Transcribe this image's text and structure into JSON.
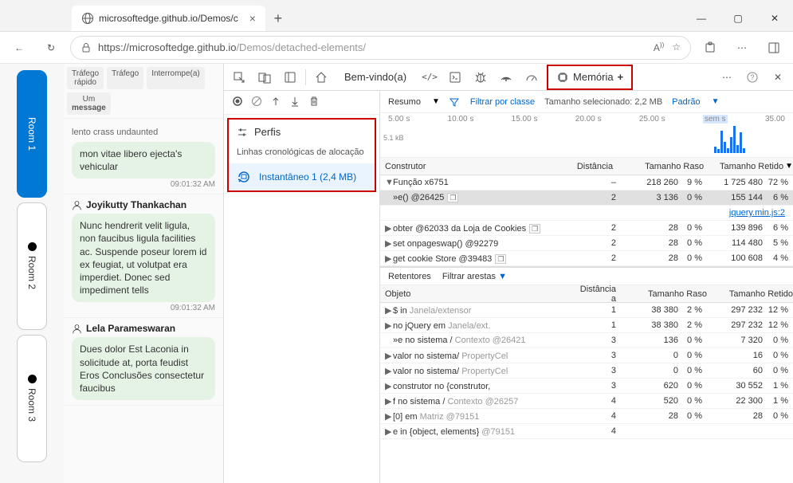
{
  "browser": {
    "tab_title": "microsoftedge.github.io/Demos/c",
    "url_prefix": "https://microsoftedge.github.io",
    "url_suffix": "/Demos/detached-elements/"
  },
  "rooms": [
    {
      "label": "Room 1",
      "active": true
    },
    {
      "label": "Room 2",
      "active": false
    },
    {
      "label": "Room 3",
      "active": false
    }
  ],
  "chat_tabs": [
    {
      "l1": "Tráfego",
      "l2": "rápido"
    },
    {
      "l1": "Tráfego",
      "l2": ""
    },
    {
      "l1": "Interrompe(a)",
      "l2": ""
    },
    {
      "l1": "Um",
      "l2": "message"
    }
  ],
  "messages": [
    {
      "preline": "lento crass undaunted",
      "text": "mon vitae libero ejecta's vehicular",
      "time": "09:01:32 AM"
    },
    {
      "user": "Joyikutty Thankachan",
      "text": "Nunc hendrerit velit ligula, non faucibus ligula facilities ac. Suspende poseur lorem id ex feugiat, ut volutpat era imperdiet. Donec sed impediment tells",
      "time": "09:01:32 AM"
    },
    {
      "user": "Lela Parameswaran",
      "text": "Dues dolor Est Laconia in solicitude at, porta feudist Eros  Conclusões consectetur faucibus"
    }
  ],
  "devtools": {
    "welcome": "Bem-vindo(a)",
    "memory": "Memória",
    "plus": "+",
    "perfis": "Perfis",
    "alloc_timelines": "Linhas cronológicas de alocação",
    "snapshot": "Instantâneo 1 (2,4 MB)"
  },
  "filter": {
    "summary": "Resumo",
    "filter_class": "Filtrar por classe",
    "size_label": "Tamanho selecionado:",
    "size_val": "2,2 MB",
    "display_label": "Padrão"
  },
  "timeline": {
    "ticks": [
      "5.00 s",
      "10.00 s",
      "15.00 s",
      "20.00 s",
      "25.00 s",
      "sem s",
      "35.00"
    ],
    "ylabel": "5.1 kB"
  },
  "constructors": {
    "headers": [
      "Construtor",
      "Distância",
      "Tamanho Raso",
      "Tamanho Retido"
    ],
    "rows": [
      {
        "tri": "▼",
        "name": "Função x6751",
        "badge": "",
        "dist": "–",
        "raw": "218 260",
        "rawp": "9 %",
        "ret": "1 725 480",
        "retp": "72 %"
      },
      {
        "tri": "",
        "name": "»e() @26425",
        "badge": "❐",
        "dist": "2",
        "raw": "3 136",
        "rawp": "0 %",
        "ret": "155 144",
        "retp": "6 %",
        "hl": true
      },
      {
        "tri": "",
        "name": "",
        "link": "jquery.min.js:2"
      },
      {
        "tri": "▶",
        "name": "obter @62033 da Loja de Cookies",
        "badge": "❐",
        "dist": "2",
        "raw": "28",
        "rawp": "0 %",
        "ret": "139 896",
        "retp": "6 %"
      },
      {
        "tri": "▶",
        "name": "set onpageswap() @92279",
        "badge": "",
        "dist": "2",
        "raw": "28",
        "rawp": "0 %",
        "ret": "114 480",
        "retp": "5 %"
      },
      {
        "tri": "▶",
        "name": "get cookie Store @39483",
        "badge": "❐",
        "dist": "2",
        "raw": "28",
        "rawp": "0 %",
        "ret": "100 608",
        "retp": "4 %"
      }
    ]
  },
  "retainers": {
    "label": "Retentores",
    "filter": "Filtrar arestas",
    "headers": [
      "Objeto",
      "Distância a",
      "Tamanho Raso",
      "Tamanho Retido"
    ],
    "rows": [
      {
        "tri": "▶",
        "name": "$ in",
        "ctx": "Janela/extensor",
        "dist": "1",
        "raw": "38 380",
        "rawp": "2 %",
        "ret": "297 232",
        "retp": "12 %"
      },
      {
        "tri": "▶",
        "name": "no jQuery em",
        "ctx": "Janela/ext.",
        "dist": "1",
        "raw": "38 380",
        "rawp": "2 %",
        "ret": "297 232",
        "retp": "12 %"
      },
      {
        "tri": "",
        "name": "»e no sistema /",
        "ctx": "Contexto @26421",
        "dist": "3",
        "raw": "136",
        "rawp": "0 %",
        "ret": "7 320",
        "retp": "0 %"
      },
      {
        "tri": "▶",
        "name": "valor no sistema/",
        "ctx": "PropertyCel",
        "dist": "3",
        "raw": "0",
        "rawp": "0 %",
        "ret": "16",
        "retp": "0 %"
      },
      {
        "tri": "▶",
        "name": "valor no sistema/",
        "ctx": "PropertyCel",
        "dist": "3",
        "raw": "0",
        "rawp": "0 %",
        "ret": "60",
        "retp": "0 %"
      },
      {
        "tri": "▶",
        "name": "construtor no {construtor,",
        "ctx": "",
        "dist": "3",
        "raw": "620",
        "rawp": "0 %",
        "ret": "30 552",
        "retp": "1 %"
      },
      {
        "tri": "▶",
        "name": "f no sistema /",
        "ctx": "Contexto @26257",
        "dist": "4",
        "raw": "520",
        "rawp": "0 %",
        "ret": "22 300",
        "retp": "1 %"
      },
      {
        "tri": "▶",
        "name": "[0] em",
        "ctx": "Matriz @79151",
        "dist": "4",
        "raw": "28",
        "rawp": "0 %",
        "ret": "28",
        "retp": "0 %"
      },
      {
        "tri": "▶",
        "name": "e in {object, elements}",
        "ctx": "@79151",
        "dist": "4",
        "raw": "",
        "rawp": "",
        "ret": "",
        "retp": ""
      }
    ]
  }
}
